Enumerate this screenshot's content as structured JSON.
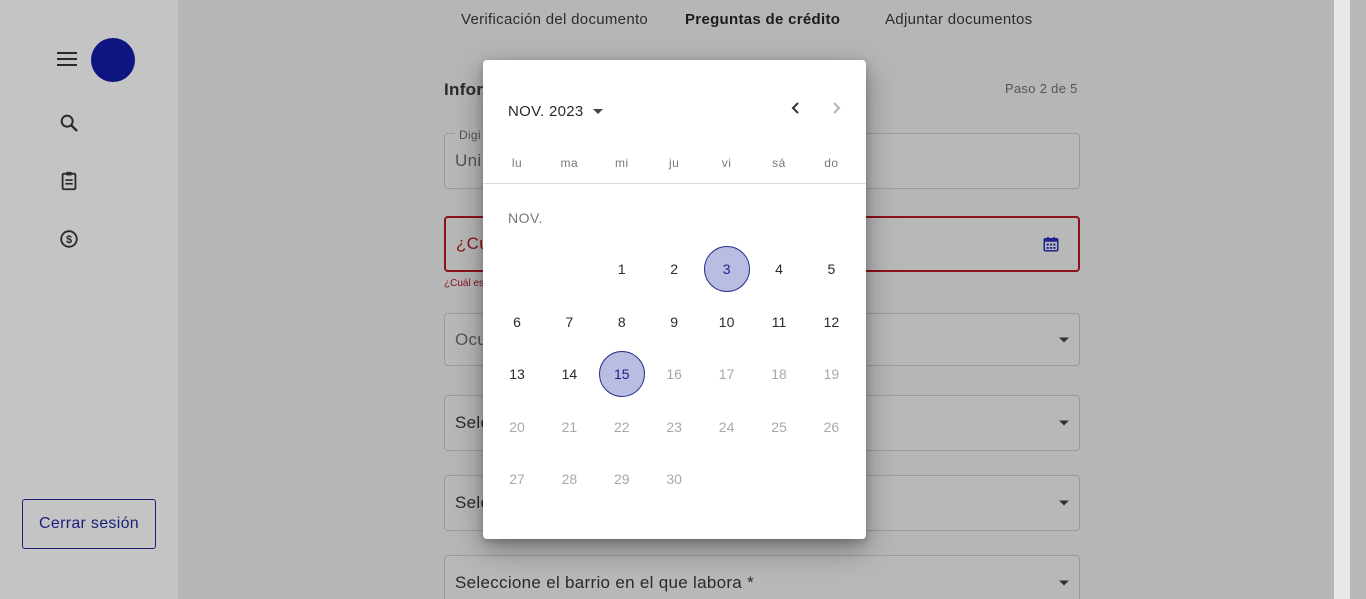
{
  "sidebar": {
    "menu_icon": "menu-icon",
    "search_icon": "search-icon",
    "clipboard_icon": "clipboard-icon",
    "dollar_icon": "dollar-circle-icon",
    "logout_label": "Cerrar sesión"
  },
  "tabs": [
    {
      "label": "Verificación del documento",
      "active": false
    },
    {
      "label": "Preguntas de crédito",
      "active": true
    },
    {
      "label": "Adjuntar documentos",
      "active": false
    }
  ],
  "form": {
    "section_title": "Infor",
    "step_label": "Paso 2 de 5",
    "field1_label": "Digi",
    "field1_value": "Uni",
    "field2_placeholder": "¿Cu",
    "field2_error": "¿Cuál es",
    "field3_placeholder": "Ocu",
    "field4_placeholder": "Sele",
    "field5_placeholder": "Sele",
    "field6_placeholder": "Seleccione el barrio en el que labora *"
  },
  "datepicker": {
    "month_year": "NOV. 2023",
    "month_label": "NOV.",
    "weekdays": [
      "lu",
      "ma",
      "mi",
      "ju",
      "vi",
      "sá",
      "do"
    ],
    "first_weekday_index": 2,
    "days_in_month": 30,
    "selected_days": [
      3,
      15
    ],
    "last_enabled_day": 15,
    "colors": {
      "selected_bg": "#b9bde2",
      "selected_border": "#2a3090",
      "disabled_text": "#a8a8a8",
      "error": "#8c1218",
      "brand": "#0e1580"
    }
  }
}
